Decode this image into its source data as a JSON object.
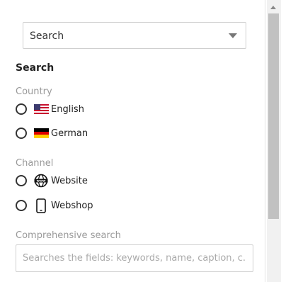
{
  "select": {
    "value": "Search",
    "icon": "chevron-down-icon"
  },
  "heading": "Search",
  "country": {
    "label": "Country",
    "options": [
      {
        "label": "English",
        "icon": "us-flag-icon"
      },
      {
        "label": "German",
        "icon": "german-flag-icon"
      }
    ]
  },
  "channel": {
    "label": "Channel",
    "options": [
      {
        "label": "Website",
        "icon": "globe-www-icon"
      },
      {
        "label": "Webshop",
        "icon": "mobile-phone-icon"
      }
    ]
  },
  "comprehensive": {
    "label": "Comprehensive search",
    "placeholder": "Searches the fields: keywords, name, caption, c..."
  },
  "colors": {
    "border": "#cfcfcf",
    "muted_text": "#999999",
    "scroll_thumb": "#c1c1c1"
  }
}
